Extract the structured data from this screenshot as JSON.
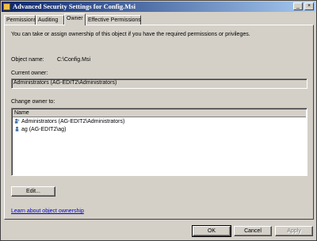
{
  "window": {
    "title": "Advanced Security Settings for Config.Msi",
    "controls": {
      "minimize": "_",
      "close": "×"
    }
  },
  "tabs": [
    {
      "label": "Permissions",
      "active": false
    },
    {
      "label": "Auditing",
      "active": false
    },
    {
      "label": "Owner",
      "active": true
    },
    {
      "label": "Effective Permissions",
      "active": false
    }
  ],
  "owner_tab": {
    "intro": "You can take or assign ownership of this object if you have the required permissions or privileges.",
    "object_name_label": "Object name:",
    "object_name_value": "C:\\Config.Msi",
    "current_owner_label": "Current owner:",
    "current_owner_value": "Administrators (AG-EDIT2\\Administrators)",
    "change_owner_label": "Change owner to:",
    "list_header": "Name",
    "owners": [
      "Administrators (AG-EDIT2\\Administrators)",
      "ag (AG-EDIT2\\ag)"
    ],
    "edit_button": "Edit...",
    "learn_link": "Learn about object ownership"
  },
  "footer": {
    "ok": "OK",
    "cancel": "Cancel",
    "apply": "Apply"
  }
}
